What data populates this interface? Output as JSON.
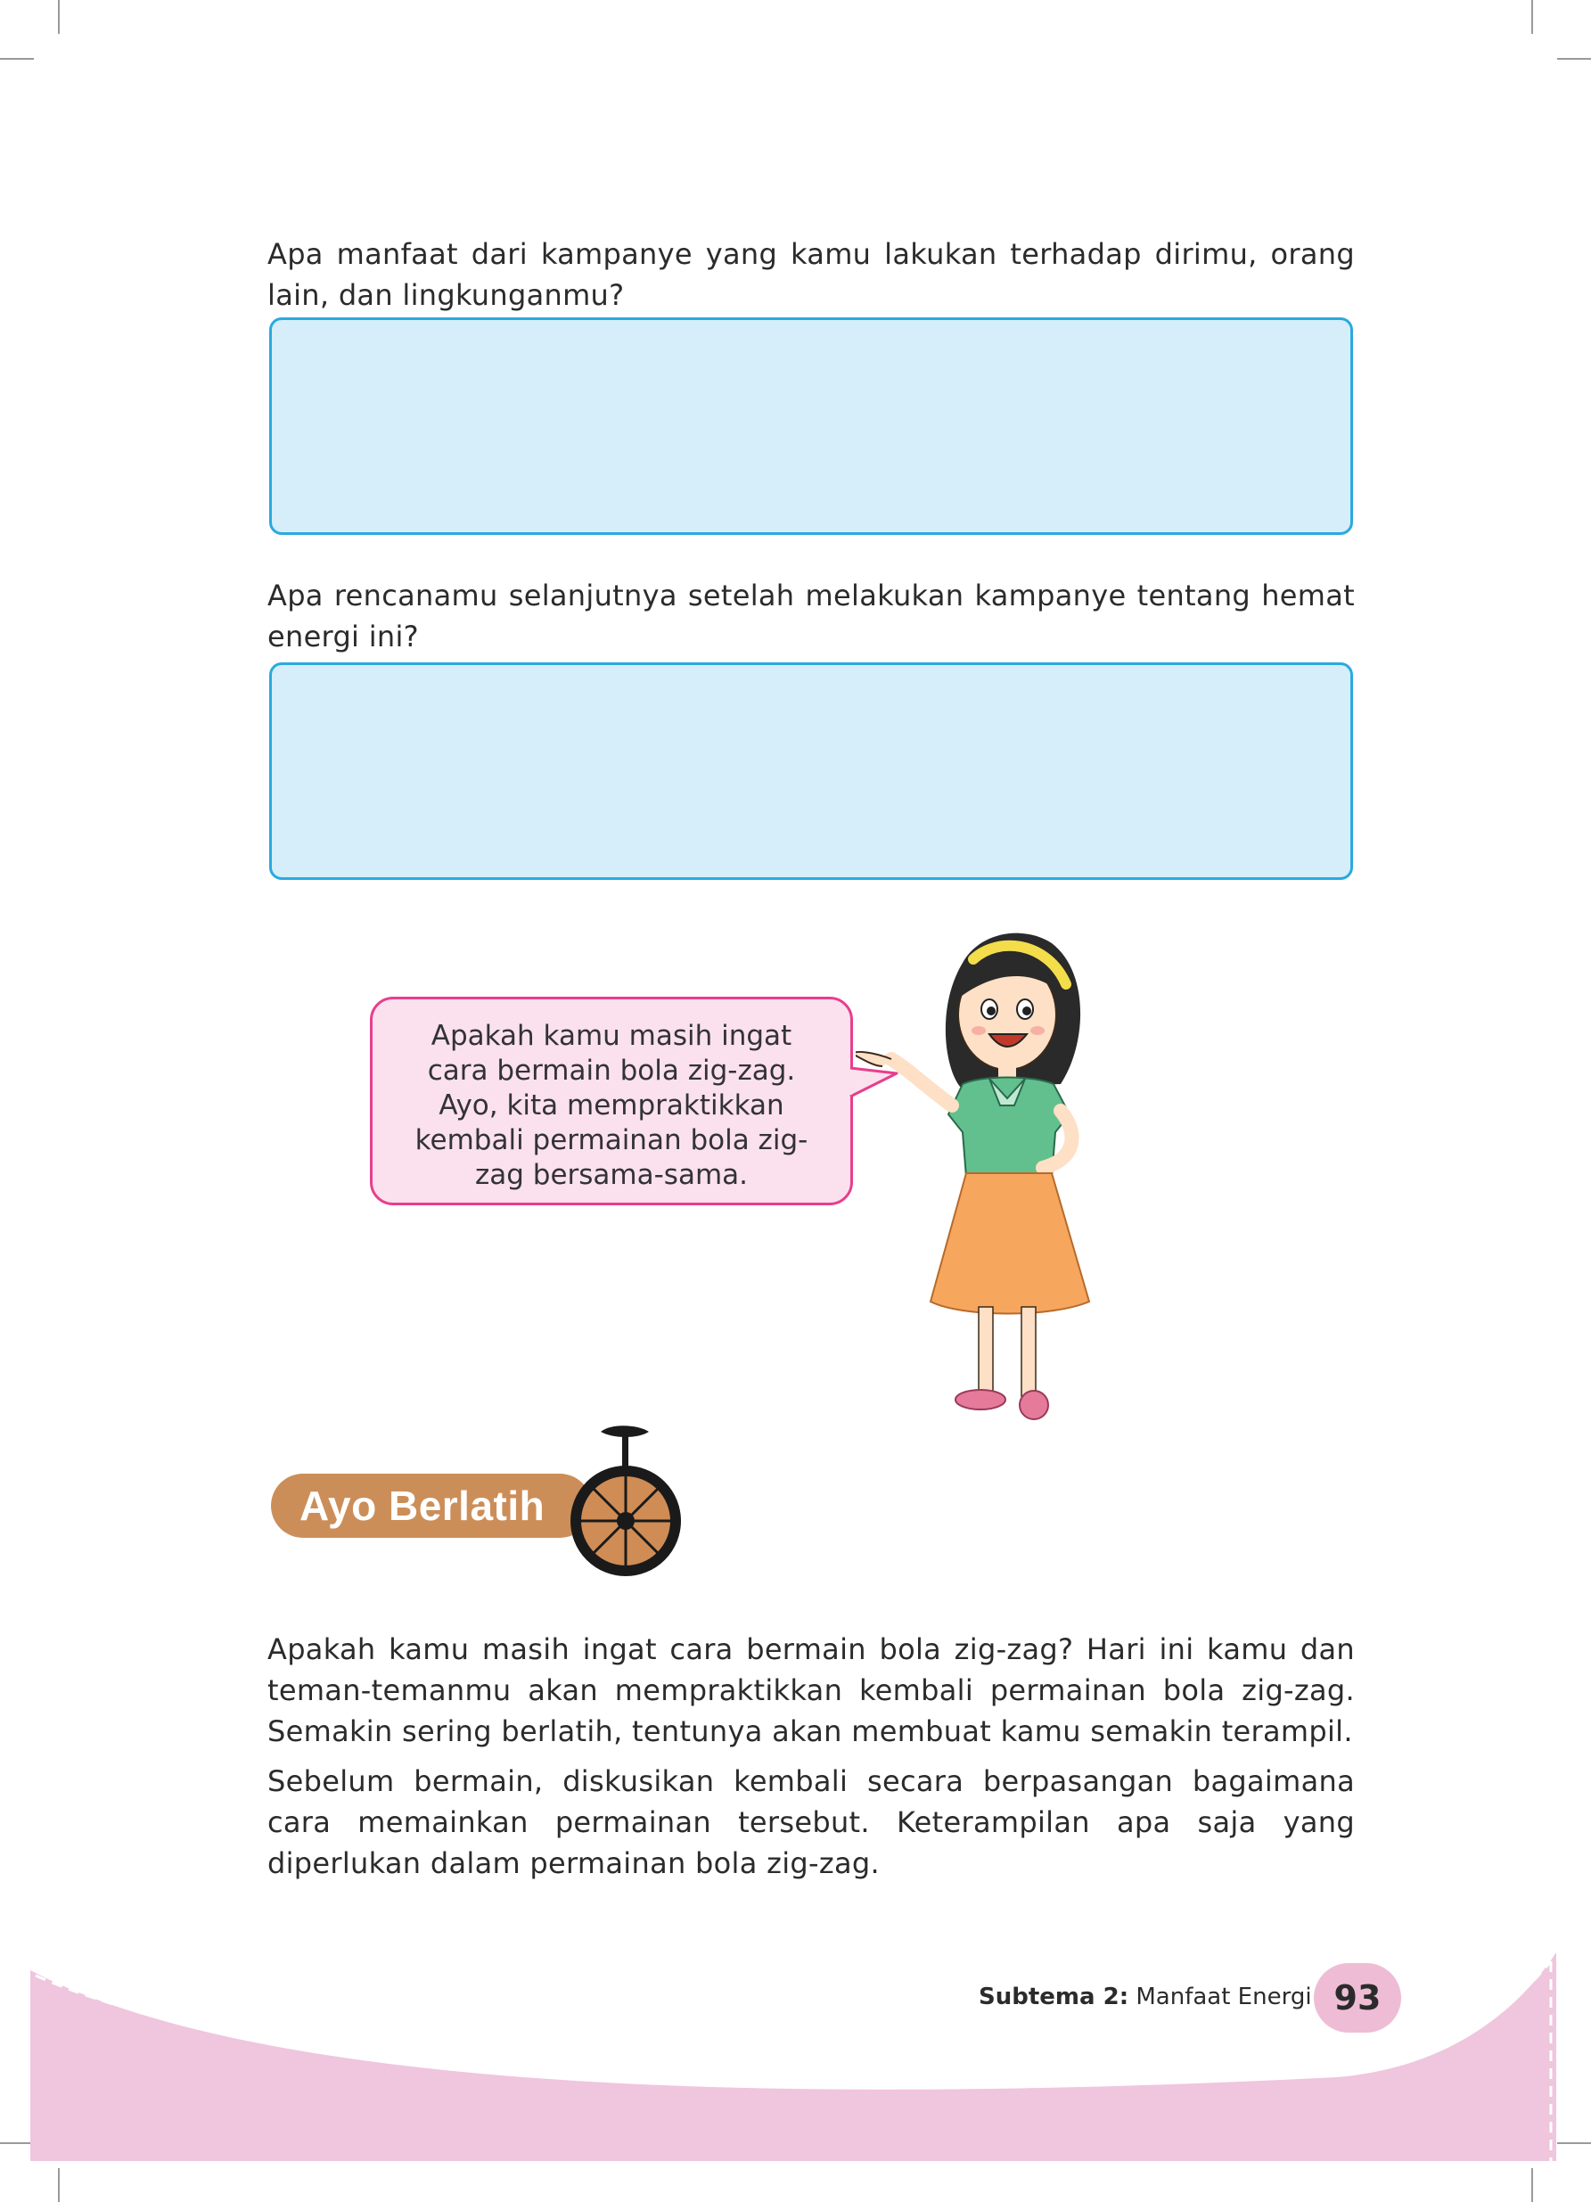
{
  "questions": [
    {
      "text": "Apa manfaat dari kampanye yang kamu lakukan terhadap dirimu, orang lain, dan lingkunganmu?"
    },
    {
      "text": "Apa rencanamu selanjutnya setelah melakukan kampanye tentang hemat energi ini?"
    }
  ],
  "speech_bubble": {
    "text": "Apakah kamu masih ingat cara bermain bola zig-zag. Ayo, kita mempraktikkan kembali permainan bola zig-zag bersama-sama."
  },
  "section_header": {
    "label": "Ayo Berlatih",
    "icon": "unicycle-icon"
  },
  "body_paragraphs": [
    "Apakah kamu masih ingat cara bermain bola zig-zag? Hari ini kamu dan teman-temanmu akan mempraktikkan kembali permainan bola zig-zag. Semakin sering berlatih, tentunya akan membuat kamu semakin terampil.",
    "Sebelum bermain, diskusikan kembali secara berpasangan bagaimana cara memainkan permainan tersebut. Keterampilan apa saja yang diperlukan dalam permainan bola zig-zag."
  ],
  "footer": {
    "subtema_label": "Subtema 2:",
    "subtema_title": "Manfaat Energi",
    "page_number": "93"
  },
  "colors": {
    "answer_box_fill": "#d5eef9",
    "answer_box_border": "#2aa9e0",
    "bubble_fill": "#fbe1ee",
    "bubble_border": "#e83e8c",
    "header_chip": "#cc8e59",
    "footer_pink": "#efc6de"
  }
}
